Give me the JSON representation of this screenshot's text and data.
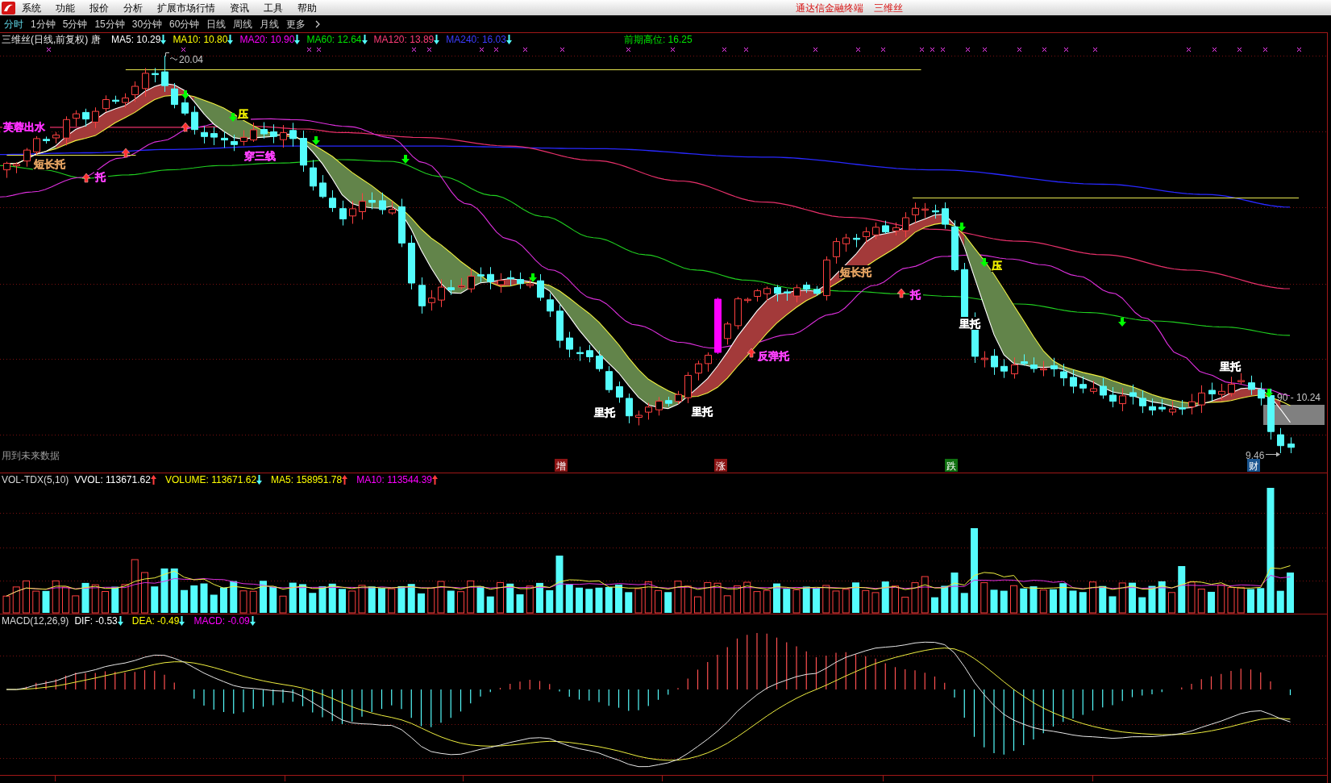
{
  "menu_bar": {
    "items": [
      "系统",
      "功能",
      "报价",
      "分析",
      "扩展市场行情",
      "资讯",
      "工具",
      "帮助"
    ],
    "title": "通达信金融终端",
    "security": "三维丝"
  },
  "period_tabs": [
    {
      "label": "分时",
      "selected": true
    },
    {
      "label": "1分钟",
      "selected": false
    },
    {
      "label": "5分钟",
      "selected": false
    },
    {
      "label": "15分钟",
      "selected": false
    },
    {
      "label": "30分钟",
      "selected": false
    },
    {
      "label": "60分钟",
      "selected": false
    },
    {
      "label": "日线",
      "selected": false
    },
    {
      "label": "周线",
      "selected": false
    },
    {
      "label": "月线",
      "selected": false
    }
  ],
  "more_button": {
    "label": "更多"
  },
  "chart_header": {
    "title": "三维丝(日线,前复权) 唐",
    "averages": [
      {
        "label": "MA5: 10.29",
        "color": "#ffffff",
        "rising": false
      },
      {
        "label": "MA10: 10.80",
        "color": "#ffff00",
        "rising": false
      },
      {
        "label": "MA20: 10.90",
        "color": "#ff00ff",
        "rising": false
      },
      {
        "label": "MA60: 12.64",
        "color": "#00e600",
        "rising": false
      },
      {
        "label": "MA120: 13.89",
        "color": "#ff3c78",
        "rising": false
      },
      {
        "label": "MA240: 16.03",
        "color": "#3c3cff",
        "rising": false
      }
    ],
    "prior_high": "前期高位: 16.25"
  },
  "main_chart": {
    "high_label": "20.04",
    "annotations": [
      {
        "text": "芙蓉出水",
        "color": "#ff30ff"
      },
      {
        "text": "短长托",
        "color": "#e0a060"
      },
      {
        "text": "托",
        "color": "#ff40ff"
      },
      {
        "text": "压",
        "color": "#e8e800"
      },
      {
        "text": "穿三线",
        "color": "#ff40ff"
      },
      {
        "text": "里托",
        "color": "#ffffff"
      },
      {
        "text": "里托",
        "color": "#ffffff"
      },
      {
        "text": "反弹托",
        "color": "#ff40ff"
      },
      {
        "text": "短长托",
        "color": "#e0a060"
      },
      {
        "text": "托",
        "color": "#ff40ff"
      },
      {
        "text": "压",
        "color": "#e8e800"
      },
      {
        "text": "里托",
        "color": "#ffffff"
      },
      {
        "text": "里托",
        "color": "#ffffff"
      }
    ],
    "range_label": "90 - 10.24",
    "note": "用到未来数据",
    "low_label": "9.46",
    "signal_tags": [
      {
        "text": "增",
        "color": "#8c1414"
      },
      {
        "text": "涨",
        "color": "#8c1414"
      },
      {
        "text": "跌",
        "color": "#107010"
      },
      {
        "text": "财",
        "color": "#1a5590"
      }
    ]
  },
  "volume_pane": {
    "name": "VOL-TDX(5,10)",
    "values": [
      {
        "label": "VVOL: 113671.62",
        "color": "#ffffff",
        "rising": true
      },
      {
        "label": "VOLUME: 113671.62",
        "color": "#ffff00",
        "rising": false
      },
      {
        "label": "MA5: 158951.78",
        "color": "#ffff00",
        "rising": true
      },
      {
        "label": "MA10: 113544.39",
        "color": "#ff00ff",
        "rising": true
      }
    ]
  },
  "macd_pane": {
    "name": "MACD(12,26,9)",
    "values": [
      {
        "label": "DIF: -0.53",
        "color": "#ffffff",
        "rising": false
      },
      {
        "label": "DEA: -0.49",
        "color": "#ffff00",
        "rising": false
      },
      {
        "label": "MACD: -0.09",
        "color": "#ff00ff",
        "rising": false
      }
    ]
  }
}
